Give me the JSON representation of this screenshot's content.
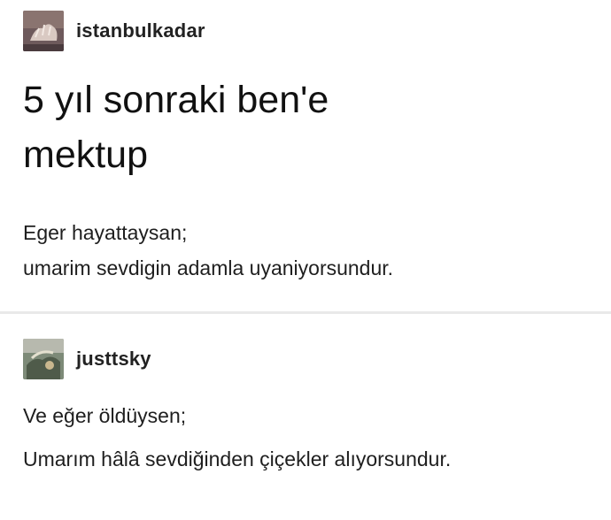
{
  "posts": [
    {
      "username": "istanbulkadar",
      "title_line1": "5 yıl sonraki ben'e",
      "title_line2": "mektup",
      "body": [
        "Eger hayattaysan;",
        "umarim sevdigin adamla uyaniyorsundur."
      ]
    },
    {
      "username": "justtsky",
      "body": [
        "Ve eğer öldüysen;",
        "Umarım hâlâ sevdiğinden çiçekler alıyorsundur."
      ]
    }
  ],
  "colors": {
    "text": "#1a1a1a",
    "divider": "#e9e9e9",
    "background": "#ffffff"
  },
  "icons": {
    "post1_avatar": "hand-icon",
    "post2_avatar": "photo-icon"
  }
}
